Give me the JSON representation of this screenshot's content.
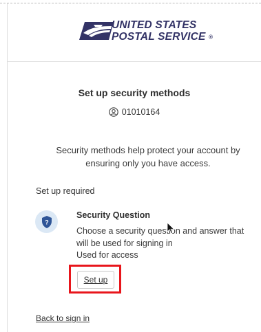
{
  "header": {
    "logo_line1": "UNITED STATES",
    "logo_line2": "POSTAL SERVICE",
    "logo_reg": "®",
    "logo_icon": "usps-eagle-logo",
    "brand_color": "#333366",
    "brand_accent": "#d21f27"
  },
  "main": {
    "title": "Set up security methods",
    "user_icon": "user-circle-icon",
    "user_id": "01010164",
    "description": "Security methods help protect your account by ensuring only you have access.",
    "section_label": "Set up required",
    "method": {
      "icon": "shield-question-icon",
      "title": "Security Question",
      "description": "Choose a security question and answer that will be used for signing in",
      "usage": "Used for access",
      "button_label": "Set up"
    },
    "back_link": "Back to sign in"
  },
  "annotation": {
    "highlight_color": "#e8151b"
  }
}
